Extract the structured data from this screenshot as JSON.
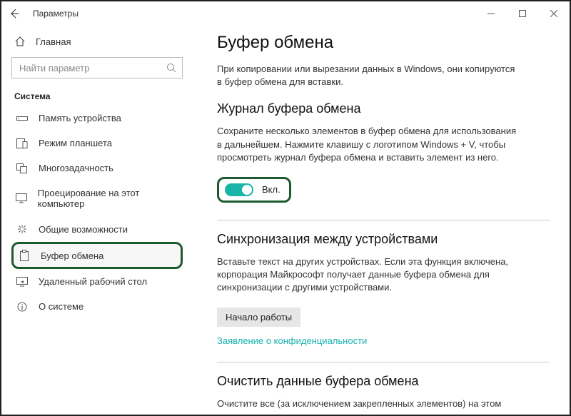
{
  "titlebar": {
    "title": "Параметры"
  },
  "sidebar": {
    "home_label": "Главная",
    "search_placeholder": "Найти параметр",
    "section_label": "Система",
    "items": [
      {
        "label": "Память устройства"
      },
      {
        "label": "Режим планшета"
      },
      {
        "label": "Многозадачность"
      },
      {
        "label": "Проецирование на этот компьютер"
      },
      {
        "label": "Общие возможности"
      },
      {
        "label": "Буфер обмена"
      },
      {
        "label": "Удаленный рабочий стол"
      },
      {
        "label": "О системе"
      }
    ],
    "selected_index": 5
  },
  "main": {
    "page_title": "Буфер обмена",
    "intro": "При копировании или вырезании данных в Windows, они копируются в буфер обмена для вставки.",
    "history": {
      "heading": "Журнал буфера обмена",
      "desc": "Сохраните несколько элементов в буфер обмена для использования в дальнейшем. Нажмите клавишу с логотипом Windows + V, чтобы просмотреть журнал буфера обмена и вставить элемент из него.",
      "toggle_label": "Вкл.",
      "toggle_on": true
    },
    "sync": {
      "heading": "Синхронизация между устройствами",
      "desc": "Вставьте текст на других устройствах. Если эта функция включена, корпорация Майкрософт получает данные буфера обмена для синхронизации с другими устройствами.",
      "button_label": "Начало работы",
      "privacy_link": "Заявление о конфиденциальности"
    },
    "clear": {
      "heading": "Очистить данные буфера обмена",
      "desc": "Очистите все (за исключением закрепленных элементов) на этом"
    }
  }
}
